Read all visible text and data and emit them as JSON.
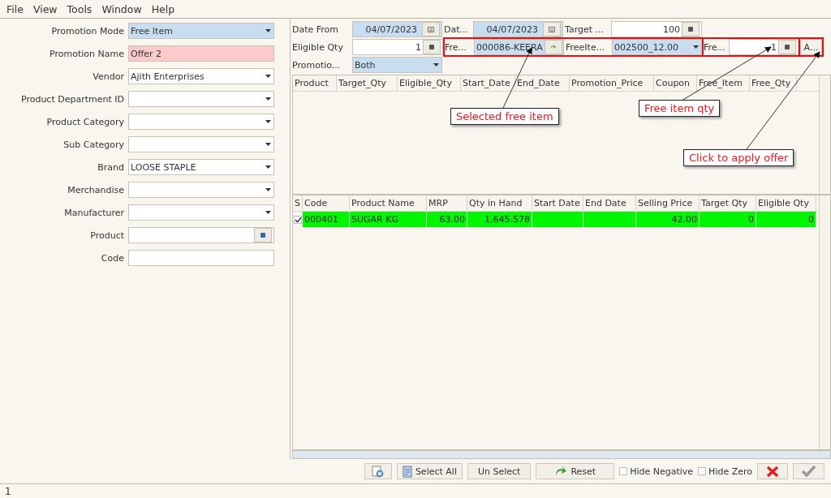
{
  "menu": [
    "File",
    "View",
    "Tools",
    "Window",
    "Help"
  ],
  "filters": [
    {
      "label": "Promotion Mode",
      "kind": "combo",
      "value": "Free Item",
      "focused": true,
      "invalid": false
    },
    {
      "label": "Promotion Name",
      "kind": "text",
      "value": "Offer 2",
      "focused": false,
      "invalid": true
    },
    {
      "label": "Vendor",
      "kind": "combo",
      "value": "Ajith Enterprises",
      "focused": false,
      "invalid": false
    },
    {
      "label": "Product Department ID",
      "kind": "combo",
      "focused": false,
      "invalid": false
    },
    {
      "label": "Product Category",
      "kind": "combo",
      "focused": false,
      "invalid": false
    },
    {
      "label": "Sub Category",
      "kind": "combo",
      "focused": false,
      "invalid": false
    },
    {
      "label": "Brand",
      "kind": "combo",
      "value": "LOOSE STAPLE",
      "focused": false,
      "invalid": false
    },
    {
      "label": "Merchandise",
      "kind": "combo",
      "focused": false,
      "invalid": false
    },
    {
      "label": "Manufacturer",
      "kind": "combo",
      "focused": false,
      "invalid": false
    },
    {
      "label": "Product",
      "kind": "lookup",
      "focused": false,
      "invalid": false
    },
    {
      "label": "Code",
      "kind": "text",
      "focused": false,
      "invalid": false
    }
  ],
  "offer_fields": [
    [
      {
        "kind": "label",
        "text": "Date From"
      },
      {
        "kind": "date",
        "value": "04/07/2023"
      },
      {
        "kind": "label",
        "text": "Dat..."
      },
      {
        "kind": "date",
        "value": "04/07/2023"
      },
      {
        "kind": "label",
        "text": "Target ..."
      },
      {
        "kind": "number",
        "value": "100"
      }
    ],
    [
      {
        "kind": "label",
        "text": "Eligible Qty"
      },
      {
        "kind": "number",
        "value": "1"
      },
      {
        "kind": "group",
        "highlighted": true,
        "items": [
          {
            "kind": "label",
            "text": "Fre..."
          },
          {
            "kind": "lookup",
            "value": "000086-KEERA"
          },
          {
            "kind": "label",
            "text": "FreeIte..."
          },
          {
            "kind": "combo",
            "value": "002500_12.00"
          }
        ]
      },
      {
        "kind": "group",
        "highlighted": true,
        "items": [
          {
            "kind": "label",
            "text": "Fre..."
          },
          {
            "kind": "number",
            "value": "1"
          }
        ]
      },
      {
        "kind": "group",
        "highlighted": true,
        "items": [
          {
            "kind": "button",
            "text": "A..."
          }
        ]
      }
    ],
    [
      {
        "kind": "label",
        "text": "Promotio..."
      },
      {
        "kind": "combo",
        "value": "Both"
      }
    ]
  ],
  "offer_grid": {
    "columns": [
      "Product",
      "Target_Qty",
      "Eligible_Qty",
      "Start_Date",
      "End_Date",
      "Promotion_Price",
      "Coupon",
      "Free_Item",
      "Free_Qty"
    ]
  },
  "product_grid": {
    "columns": [
      "S",
      "Code",
      "Product Name",
      "MRP",
      "Qty in Hand",
      "Start Date",
      "End Date",
      "Selling Price",
      "Target Qty",
      "Eligible Qty"
    ],
    "rows": [
      {
        "selected": true,
        "cells": [
          "",
          "000401",
          "SUGAR KG",
          "63.00",
          "1,645.578",
          "",
          "",
          "42.00",
          "0",
          "0"
        ]
      }
    ]
  },
  "toolbar": [
    {
      "kind": "preview"
    },
    {
      "kind": "select",
      "label": "Select All"
    },
    {
      "kind": "plain",
      "label": "Un Select"
    },
    {
      "kind": "reset",
      "label": "Reset"
    },
    {
      "kind": "check",
      "label": "Hide Negative",
      "checked": false
    },
    {
      "kind": "check",
      "label": "Hide Zero",
      "checked": false
    },
    {
      "kind": "cancel"
    },
    {
      "kind": "ok",
      "disabled": true
    }
  ],
  "status_bar": "1",
  "callouts": [
    {
      "text": "Selected free item"
    },
    {
      "text": "Free item qty"
    },
    {
      "text": "Click to apply offer"
    }
  ]
}
